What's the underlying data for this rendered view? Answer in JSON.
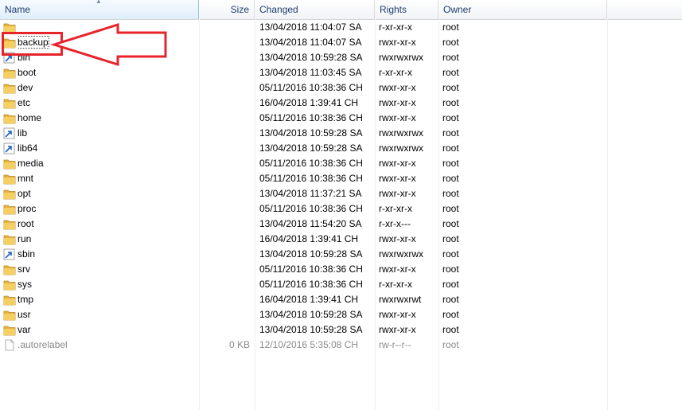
{
  "columns": {
    "name": "Name",
    "size": "Size",
    "changed": "Changed",
    "rights": "Rights",
    "owner": "Owner"
  },
  "colors": {
    "highlight": "#e8242b",
    "folder": "#e6b43c",
    "link": "#2060c0"
  },
  "rows": [
    {
      "name": "",
      "size": "",
      "changed": "13/04/2018 11:04:07 SA",
      "rights": "r-xr-xr-x",
      "owner": "root",
      "icon": "parent-folder-icon"
    },
    {
      "name": "backup",
      "size": "",
      "changed": "13/04/2018 11:04:07 SA",
      "rights": "rwxr-xr-x",
      "owner": "root",
      "icon": "folder-icon"
    },
    {
      "name": "bin",
      "size": "",
      "changed": "13/04/2018 10:59:28 SA",
      "rights": "rwxrwxrwx",
      "owner": "root",
      "icon": "link-icon"
    },
    {
      "name": "boot",
      "size": "",
      "changed": "13/04/2018 11:03:45 SA",
      "rights": "r-xr-xr-x",
      "owner": "root",
      "icon": "folder-icon"
    },
    {
      "name": "dev",
      "size": "",
      "changed": "05/11/2016 10:38:36 CH",
      "rights": "rwxr-xr-x",
      "owner": "root",
      "icon": "folder-icon"
    },
    {
      "name": "etc",
      "size": "",
      "changed": "16/04/2018 1:39:41 CH",
      "rights": "rwxr-xr-x",
      "owner": "root",
      "icon": "folder-icon"
    },
    {
      "name": "home",
      "size": "",
      "changed": "05/11/2016 10:38:36 CH",
      "rights": "rwxr-xr-x",
      "owner": "root",
      "icon": "folder-icon"
    },
    {
      "name": "lib",
      "size": "",
      "changed": "13/04/2018 10:59:28 SA",
      "rights": "rwxrwxrwx",
      "owner": "root",
      "icon": "link-icon"
    },
    {
      "name": "lib64",
      "size": "",
      "changed": "13/04/2018 10:59:28 SA",
      "rights": "rwxrwxrwx",
      "owner": "root",
      "icon": "link-icon"
    },
    {
      "name": "media",
      "size": "",
      "changed": "05/11/2016 10:38:36 CH",
      "rights": "rwxr-xr-x",
      "owner": "root",
      "icon": "folder-icon"
    },
    {
      "name": "mnt",
      "size": "",
      "changed": "05/11/2016 10:38:36 CH",
      "rights": "rwxr-xr-x",
      "owner": "root",
      "icon": "folder-icon"
    },
    {
      "name": "opt",
      "size": "",
      "changed": "13/04/2018 11:37:21 SA",
      "rights": "rwxr-xr-x",
      "owner": "root",
      "icon": "folder-icon"
    },
    {
      "name": "proc",
      "size": "",
      "changed": "05/11/2016 10:38:36 CH",
      "rights": "r-xr-xr-x",
      "owner": "root",
      "icon": "folder-icon"
    },
    {
      "name": "root",
      "size": "",
      "changed": "13/04/2018 11:54:20 SA",
      "rights": "r-xr-x---",
      "owner": "root",
      "icon": "folder-icon"
    },
    {
      "name": "run",
      "size": "",
      "changed": "16/04/2018 1:39:41 CH",
      "rights": "rwxr-xr-x",
      "owner": "root",
      "icon": "folder-icon"
    },
    {
      "name": "sbin",
      "size": "",
      "changed": "13/04/2018 10:59:28 SA",
      "rights": "rwxrwxrwx",
      "owner": "root",
      "icon": "link-icon"
    },
    {
      "name": "srv",
      "size": "",
      "changed": "05/11/2016 10:38:36 CH",
      "rights": "rwxr-xr-x",
      "owner": "root",
      "icon": "folder-icon"
    },
    {
      "name": "sys",
      "size": "",
      "changed": "05/11/2016 10:38:36 CH",
      "rights": "r-xr-xr-x",
      "owner": "root",
      "icon": "folder-icon"
    },
    {
      "name": "tmp",
      "size": "",
      "changed": "16/04/2018 1:39:41 CH",
      "rights": "rwxrwxrwt",
      "owner": "root",
      "icon": "folder-icon"
    },
    {
      "name": "usr",
      "size": "",
      "changed": "13/04/2018 10:59:28 SA",
      "rights": "rwxr-xr-x",
      "owner": "root",
      "icon": "folder-icon"
    },
    {
      "name": "var",
      "size": "",
      "changed": "13/04/2018 10:59:28 SA",
      "rights": "rwxr-xr-x",
      "owner": "root",
      "icon": "folder-icon"
    },
    {
      "name": ".autorelabel",
      "size": "0 KB",
      "changed": "12/10/2016 5:35:08 CH",
      "rights": "rw-r--r--",
      "owner": "root",
      "icon": "file-icon",
      "hidden": true
    }
  ]
}
